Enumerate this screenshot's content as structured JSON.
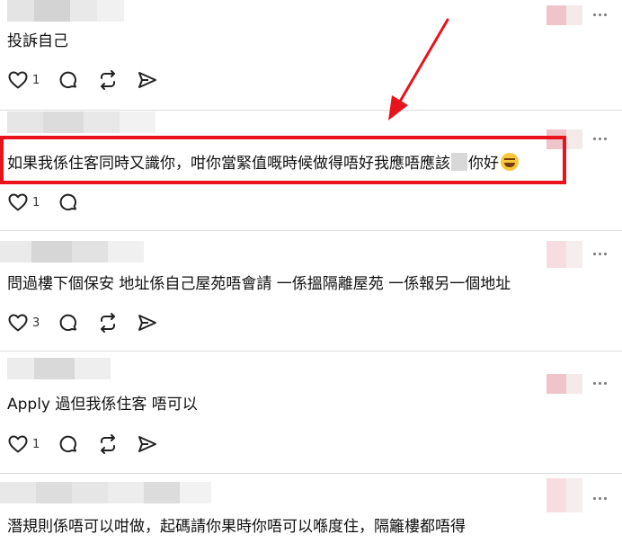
{
  "posts": [
    {
      "text": "投訴自己",
      "likes": "1",
      "actions": [
        "like-icon",
        "comment-icon",
        "repost-icon",
        "share-icon"
      ]
    },
    {
      "text_before": "如果我係住客同時又識你，咁你當緊值嘅時候做得唔好我應唔應該",
      "text_after": "你好",
      "likes": "1",
      "highlighted": true,
      "highlight_color": "#e8131b"
    },
    {
      "text": "問過樓下個保安 地址係自己屋苑唔會請 一係搵隔離屋苑 一係報另一個地址",
      "likes": "3"
    },
    {
      "text": "Apply 過但我係住客 唔可以",
      "likes": "1"
    },
    {
      "text": "潛規則係唔可以咁做，起碼請你果時你唔可以喺度住，隔籬樓都唔得"
    }
  ],
  "colors": {
    "accent_red": "#e8131b",
    "divider": "#dcdcdc"
  }
}
